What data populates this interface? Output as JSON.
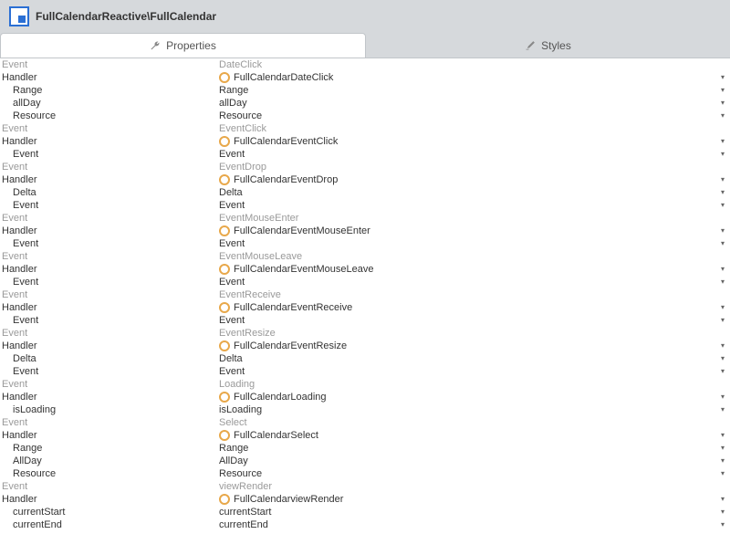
{
  "header": {
    "title": "FullCalendarReactive\\FullCalendar"
  },
  "tabs": {
    "properties": "Properties",
    "styles": "Styles"
  },
  "rows": [
    {
      "t": "evt",
      "label": "Event",
      "value": "DateClick"
    },
    {
      "t": "handler",
      "label": "Handler",
      "value": "FullCalendarDateClick"
    },
    {
      "t": "param",
      "label": "Range",
      "value": "Range"
    },
    {
      "t": "param",
      "label": "allDay",
      "value": "allDay"
    },
    {
      "t": "param",
      "label": "Resource",
      "value": "Resource"
    },
    {
      "t": "evt",
      "label": "Event",
      "value": "EventClick"
    },
    {
      "t": "handler",
      "label": "Handler",
      "value": "FullCalendarEventClick"
    },
    {
      "t": "param",
      "label": "Event",
      "value": "Event"
    },
    {
      "t": "evt",
      "label": "Event",
      "value": "EventDrop"
    },
    {
      "t": "handler",
      "label": "Handler",
      "value": "FullCalendarEventDrop"
    },
    {
      "t": "param",
      "label": "Delta",
      "value": "Delta"
    },
    {
      "t": "param",
      "label": "Event",
      "value": "Event"
    },
    {
      "t": "evt",
      "label": "Event",
      "value": "EventMouseEnter"
    },
    {
      "t": "handler",
      "label": "Handler",
      "value": "FullCalendarEventMouseEnter"
    },
    {
      "t": "param",
      "label": "Event",
      "value": "Event"
    },
    {
      "t": "evt",
      "label": "Event",
      "value": "EventMouseLeave"
    },
    {
      "t": "handler",
      "label": "Handler",
      "value": "FullCalendarEventMouseLeave"
    },
    {
      "t": "param",
      "label": "Event",
      "value": "Event"
    },
    {
      "t": "evt",
      "label": "Event",
      "value": "EventReceive"
    },
    {
      "t": "handler",
      "label": "Handler",
      "value": "FullCalendarEventReceive"
    },
    {
      "t": "param",
      "label": "Event",
      "value": "Event"
    },
    {
      "t": "evt",
      "label": "Event",
      "value": "EventResize"
    },
    {
      "t": "handler",
      "label": "Handler",
      "value": "FullCalendarEventResize"
    },
    {
      "t": "param",
      "label": "Delta",
      "value": "Delta"
    },
    {
      "t": "param",
      "label": "Event",
      "value": "Event"
    },
    {
      "t": "evt",
      "label": "Event",
      "value": "Loading"
    },
    {
      "t": "handler",
      "label": "Handler",
      "value": "FullCalendarLoading"
    },
    {
      "t": "param",
      "label": "isLoading",
      "value": "isLoading"
    },
    {
      "t": "evt",
      "label": "Event",
      "value": "Select"
    },
    {
      "t": "handler",
      "label": "Handler",
      "value": "FullCalendarSelect"
    },
    {
      "t": "param",
      "label": "Range",
      "value": "Range"
    },
    {
      "t": "param",
      "label": "AllDay",
      "value": "AllDay"
    },
    {
      "t": "param",
      "label": "Resource",
      "value": "Resource"
    },
    {
      "t": "evt",
      "label": "Event",
      "value": "viewRender"
    },
    {
      "t": "handler",
      "label": "Handler",
      "value": "FullCalendarviewRender"
    },
    {
      "t": "param",
      "label": "currentStart",
      "value": "currentStart"
    },
    {
      "t": "param",
      "label": "currentEnd",
      "value": "currentEnd"
    }
  ]
}
